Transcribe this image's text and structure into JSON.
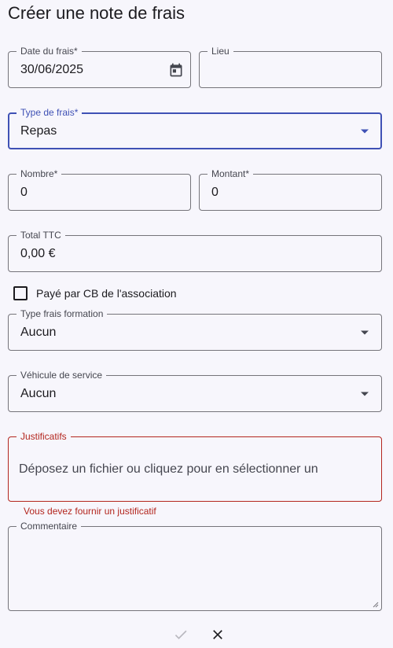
{
  "page": {
    "title": "Créer une note de frais"
  },
  "fields": {
    "date": {
      "label": "Date du frais*",
      "value": "30/06/2025",
      "icon": "calendar-icon"
    },
    "lieu": {
      "label": "Lieu",
      "value": ""
    },
    "type": {
      "label": "Type de frais*",
      "value": "Repas"
    },
    "nombre": {
      "label": "Nombre*",
      "value": "0"
    },
    "montant": {
      "label": "Montant*",
      "value": "0"
    },
    "total": {
      "label": "Total TTC",
      "value": "0,00 €"
    },
    "paye_cb": {
      "label": "Payé par CB de l'association",
      "checked": false
    },
    "formation": {
      "label": "Type frais formation",
      "value": "Aucun"
    },
    "vehicule": {
      "label": "Véhicule de service",
      "value": "Aucun"
    },
    "justificatifs": {
      "label": "Justificatifs",
      "placeholder": "Déposez un fichier ou cliquez pour en sélectionner un",
      "error": "Vous devez fournir un justificatif"
    },
    "commentaire": {
      "label": "Commentaire",
      "value": ""
    }
  },
  "actions": {
    "confirm_icon": "check-icon",
    "cancel_icon": "close-icon"
  },
  "colors": {
    "accent": "#3f51b5",
    "error": "#b3261e",
    "background": "#f7f6fc"
  }
}
